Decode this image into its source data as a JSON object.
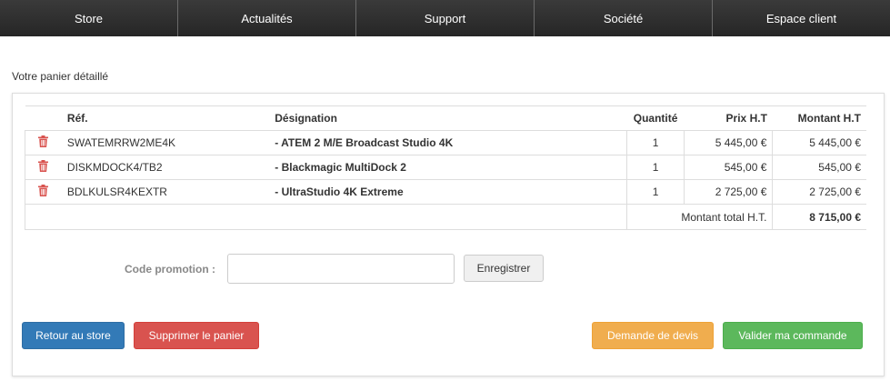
{
  "nav": {
    "items": [
      {
        "label": "Store"
      },
      {
        "label": "Actualités"
      },
      {
        "label": "Support"
      },
      {
        "label": "Société"
      },
      {
        "label": "Espace client"
      }
    ]
  },
  "cart": {
    "title": "Votre panier détaillé",
    "headers": {
      "ref": "Réf.",
      "designation": "Désignation",
      "quantity": "Quantité",
      "unit_price": "Prix H.T",
      "amount": "Montant H.T"
    },
    "rows": [
      {
        "ref": "SWATEMRRW2ME4K",
        "designation": "- ATEM 2 M/E Broadcast Studio 4K",
        "quantity": "1",
        "unit_price": "5 445,00 €",
        "amount": "5 445,00 €"
      },
      {
        "ref": "DISKMDOCK4/TB2",
        "designation": "- Blackmagic MultiDock 2",
        "quantity": "1",
        "unit_price": "545,00 €",
        "amount": "545,00 €"
      },
      {
        "ref": "BDLKULSR4KEXTR",
        "designation": "- UltraStudio 4K Extreme",
        "quantity": "1",
        "unit_price": "2 725,00 €",
        "amount": "2 725,00 €"
      }
    ],
    "total_label": "Montant total H.T.",
    "total_value": "8 715,00 €",
    "delete_icon": "trash-icon",
    "delete_icon_color": "#d9534f"
  },
  "promo": {
    "label": "Code promotion :",
    "value": "",
    "placeholder": "",
    "submit_label": "Enregistrer"
  },
  "actions": {
    "back_label": "Retour au store",
    "clear_label": "Supprimer le panier",
    "quote_label": "Demande de devis",
    "validate_label": "Valider ma commande"
  },
  "colors": {
    "nav_bg": "#2f2f2f",
    "primary": "#337ab7",
    "danger": "#d9534f",
    "warning": "#f0ad4e",
    "success": "#5cb85c"
  }
}
